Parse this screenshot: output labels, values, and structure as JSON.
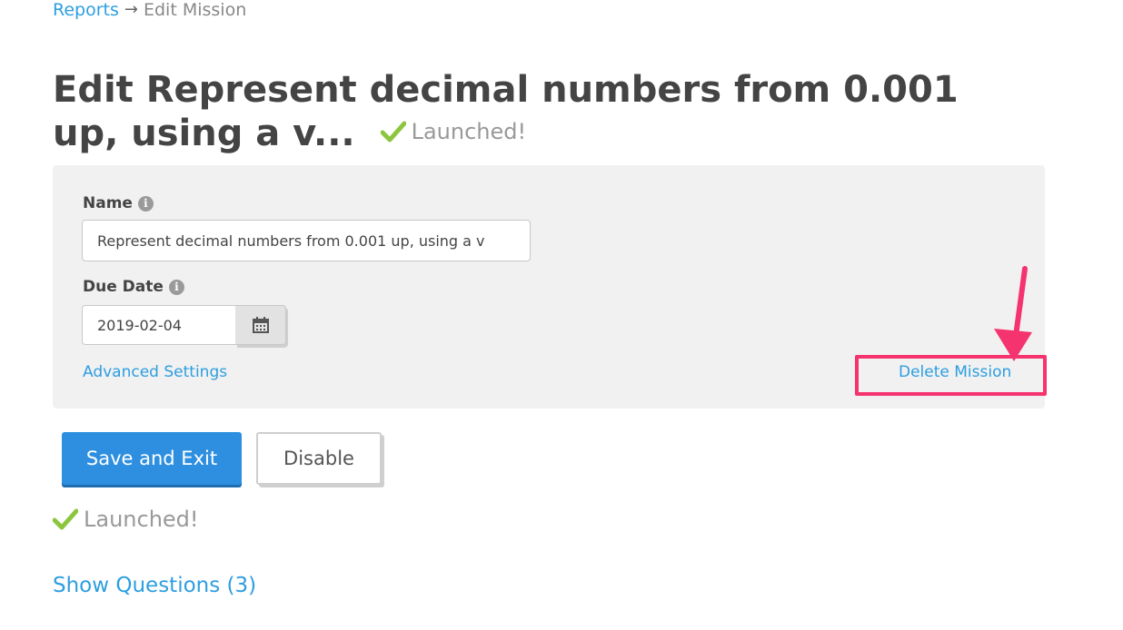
{
  "breadcrumb": {
    "parent": "Reports",
    "separator": "→",
    "current": "Edit Mission"
  },
  "header": {
    "title": "Edit Represent decimal numbers from 0.001 up, using a v...",
    "status": "Launched!"
  },
  "form": {
    "name_label": "Name",
    "name_value": "Represent decimal numbers from 0.001 up, using a v",
    "due_date_label": "Due Date",
    "due_date_value": "2019-02-04",
    "advanced_settings": "Advanced Settings",
    "delete_mission": "Delete Mission"
  },
  "actions": {
    "save_label": "Save and Exit",
    "disable_label": "Disable"
  },
  "status": {
    "launched": "Launched!"
  },
  "questions": {
    "show_label": "Show Questions (3)"
  },
  "icons": {
    "check": "check-icon",
    "info": "info-icon",
    "calendar": "calendar-icon",
    "annotation_arrow": "arrow-icon"
  },
  "colors": {
    "link": "#2d9ee0",
    "primary": "#2e8fe0",
    "check": "#8cc63f",
    "highlight": "#f5336f"
  }
}
